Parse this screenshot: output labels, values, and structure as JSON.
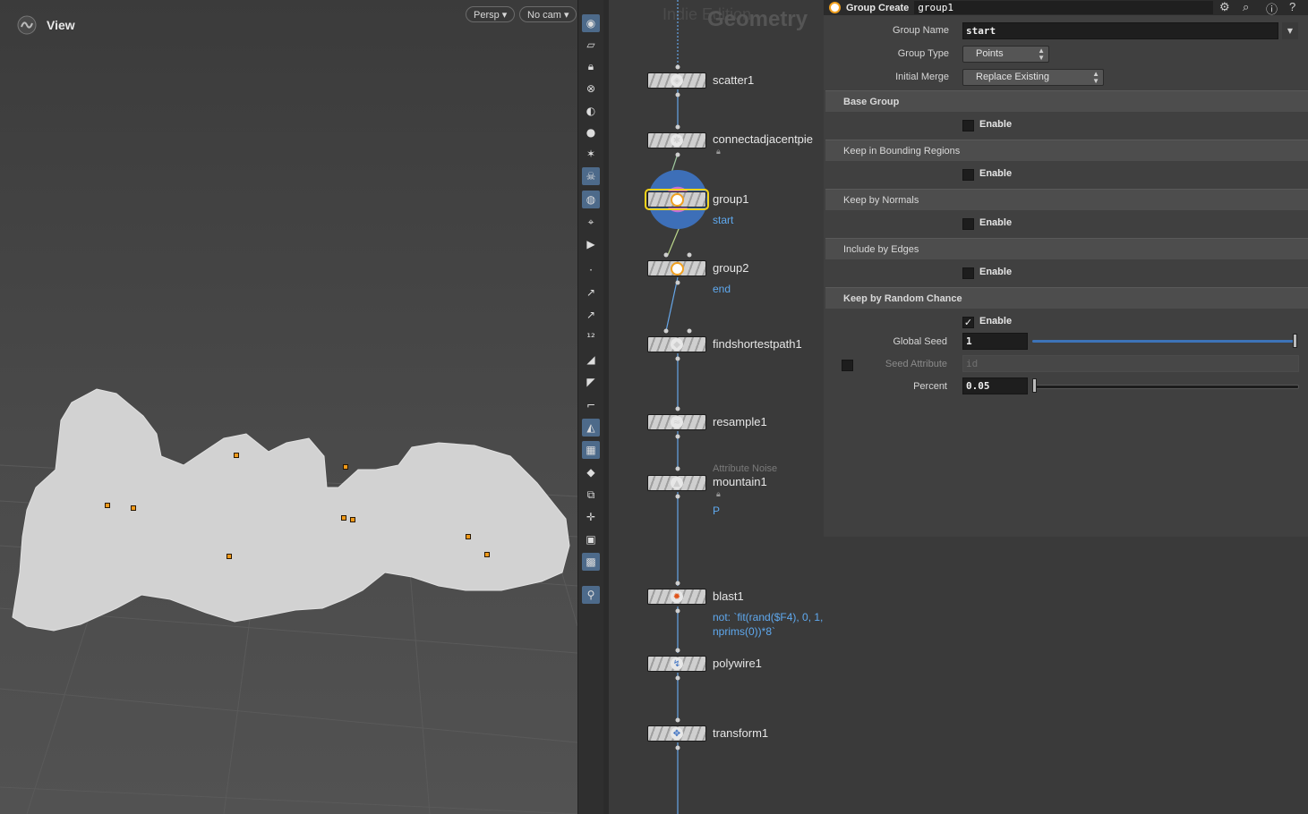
{
  "viewport": {
    "title": "View",
    "persp_menu": "Persp ▾",
    "cam_menu": "No cam ▾"
  },
  "toolbar_icons": [
    "eye-icon",
    "wireframe-icon",
    "lock-icon",
    "ghost-icon",
    "shading-icon",
    "light-icon",
    "light-bulb-icon",
    "skull-icon",
    "camera-icon",
    "snapshot-icon",
    "flipbook-icon",
    "point-display-icon",
    "normal-icon",
    "vector-icon",
    "point-numbers-icon",
    "prim-normal-icon",
    "prim-numbers-icon",
    "uv-icon",
    "shaded-open-icon",
    "texture-icon",
    "backface-icon",
    "mirror-icon",
    "handle-icon",
    "box-icon",
    "screenshot-icon",
    "pin-icon"
  ],
  "network": {
    "watermark_edition": "Indie Edition",
    "watermark_context": "Geometry",
    "nodes": [
      {
        "name": "scatter1"
      },
      {
        "name": "connectadjacentpie"
      },
      {
        "name": "group1",
        "sub": "start"
      },
      {
        "name": "group2",
        "sub": "end"
      },
      {
        "name": "findshortestpath1"
      },
      {
        "name": "resample1"
      },
      {
        "name": "mountain1",
        "type_label": "Attribute Noise",
        "sub": "P"
      },
      {
        "name": "blast1",
        "sub_line1": "not: `fit(rand($F4), 0, 1, 0,",
        "sub_line2": "nprims(0))*8`"
      },
      {
        "name": "polywire1"
      },
      {
        "name": "transform1"
      }
    ]
  },
  "params": {
    "node_type": "Group Create",
    "node_name": "group1",
    "group_name": {
      "label": "Group Name",
      "value": "start"
    },
    "group_type": {
      "label": "Group Type",
      "value": "Points"
    },
    "initial_merge": {
      "label": "Initial Merge",
      "value": "Replace Existing"
    },
    "sections": [
      {
        "title": "Base Group",
        "enable_label": "Enable",
        "checked": false
      },
      {
        "title": "Keep in Bounding Regions",
        "enable_label": "Enable",
        "checked": false
      },
      {
        "title": "Keep by Normals",
        "enable_label": "Enable",
        "checked": false
      },
      {
        "title": "Include by Edges",
        "enable_label": "Enable",
        "checked": false
      },
      {
        "title": "Keep by Random Chance",
        "enable_label": "Enable",
        "checked": true
      }
    ],
    "global_seed": {
      "label": "Global Seed",
      "value": "1",
      "fraction": 1.0
    },
    "seed_attribute": {
      "label": "Seed Attribute",
      "value": "id"
    },
    "percent": {
      "label": "Percent",
      "value": "0.05",
      "fraction": 0.0
    }
  },
  "colors": {
    "selection_outline": "#f3d31a",
    "point_marker": "#f09a19",
    "slider_blue": "#3d73b8",
    "sub_label_blue": "#5fa9ef"
  }
}
